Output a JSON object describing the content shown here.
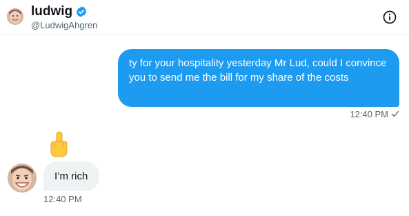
{
  "conversation": {
    "recipient": {
      "display_name": "ludwig",
      "handle": "@LudwigAhgren",
      "verified": true
    },
    "info_icon": "info-circle-icon",
    "accent_color": "#1d9bf0"
  },
  "messages": [
    {
      "direction": "outgoing",
      "text": "ty for your hospitality yesterday Mr Lud, could I convince you to send me the bill for my share of the costs",
      "time": "12:40 PM",
      "status_icon": "checkmark-icon"
    },
    {
      "direction": "incoming",
      "text": "I’m rich",
      "time": "12:40 PM",
      "reaction": "middle-finger-emoji"
    }
  ]
}
